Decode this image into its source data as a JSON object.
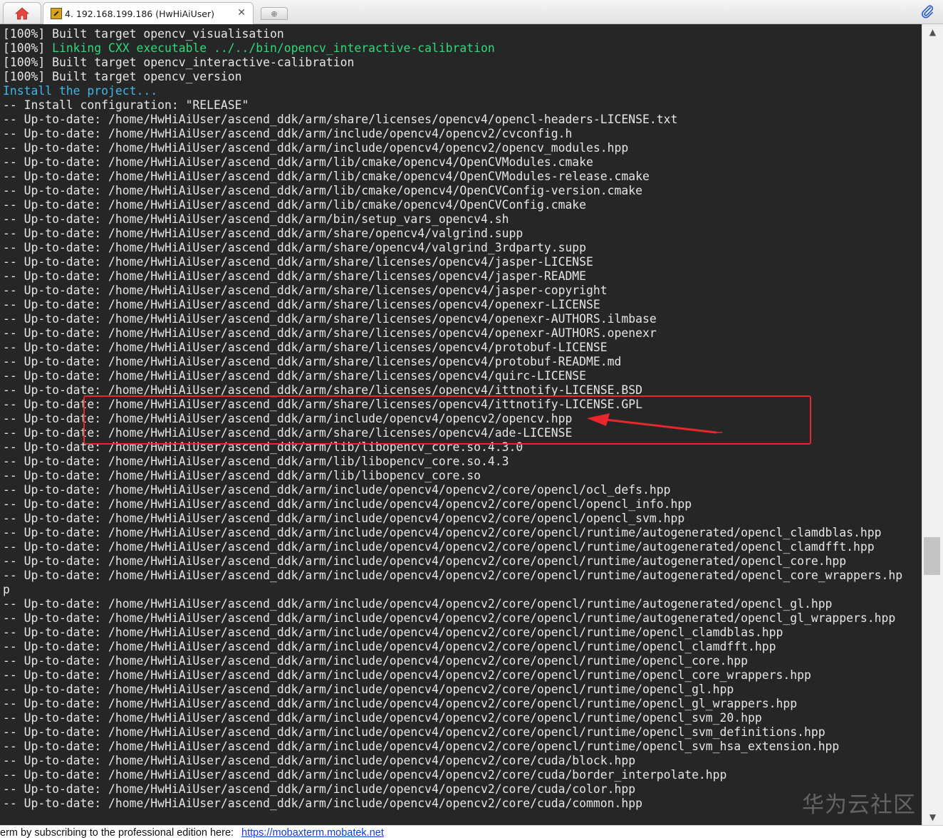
{
  "tabbar": {
    "session_tab_title": "4. 192.168.199.186 (HwHiAiUser)",
    "close_glyph": "✕",
    "new_tab_glyph": "⊕"
  },
  "terminal": {
    "lines": [
      {
        "text": "[100%] Built target opencv_visualisation",
        "color": "default"
      },
      {
        "text": "[100%] Linking CXX executable ../../bin/opencv_interactive-calibration",
        "color": "green",
        "prefix": "[100%] "
      },
      {
        "text": "[100%] Built target opencv_interactive-calibration",
        "color": "default"
      },
      {
        "text": "[100%] Built target opencv_version",
        "color": "default"
      },
      {
        "text": "Install the project...",
        "color": "cyan"
      },
      {
        "text": "-- Install configuration: \"RELEASE\"",
        "color": "default"
      },
      {
        "text": "-- Up-to-date: /home/HwHiAiUser/ascend_ddk/arm/share/licenses/opencv4/opencl-headers-LICENSE.txt",
        "color": "default"
      },
      {
        "text": "-- Up-to-date: /home/HwHiAiUser/ascend_ddk/arm/include/opencv4/opencv2/cvconfig.h",
        "color": "default"
      },
      {
        "text": "-- Up-to-date: /home/HwHiAiUser/ascend_ddk/arm/include/opencv4/opencv2/opencv_modules.hpp",
        "color": "default"
      },
      {
        "text": "-- Up-to-date: /home/HwHiAiUser/ascend_ddk/arm/lib/cmake/opencv4/OpenCVModules.cmake",
        "color": "default"
      },
      {
        "text": "-- Up-to-date: /home/HwHiAiUser/ascend_ddk/arm/lib/cmake/opencv4/OpenCVModules-release.cmake",
        "color": "default"
      },
      {
        "text": "-- Up-to-date: /home/HwHiAiUser/ascend_ddk/arm/lib/cmake/opencv4/OpenCVConfig-version.cmake",
        "color": "default"
      },
      {
        "text": "-- Up-to-date: /home/HwHiAiUser/ascend_ddk/arm/lib/cmake/opencv4/OpenCVConfig.cmake",
        "color": "default"
      },
      {
        "text": "-- Up-to-date: /home/HwHiAiUser/ascend_ddk/arm/bin/setup_vars_opencv4.sh",
        "color": "default"
      },
      {
        "text": "-- Up-to-date: /home/HwHiAiUser/ascend_ddk/arm/share/opencv4/valgrind.supp",
        "color": "default"
      },
      {
        "text": "-- Up-to-date: /home/HwHiAiUser/ascend_ddk/arm/share/opencv4/valgrind_3rdparty.supp",
        "color": "default"
      },
      {
        "text": "-- Up-to-date: /home/HwHiAiUser/ascend_ddk/arm/share/licenses/opencv4/jasper-LICENSE",
        "color": "default"
      },
      {
        "text": "-- Up-to-date: /home/HwHiAiUser/ascend_ddk/arm/share/licenses/opencv4/jasper-README",
        "color": "default"
      },
      {
        "text": "-- Up-to-date: /home/HwHiAiUser/ascend_ddk/arm/share/licenses/opencv4/jasper-copyright",
        "color": "default"
      },
      {
        "text": "-- Up-to-date: /home/HwHiAiUser/ascend_ddk/arm/share/licenses/opencv4/openexr-LICENSE",
        "color": "default"
      },
      {
        "text": "-- Up-to-date: /home/HwHiAiUser/ascend_ddk/arm/share/licenses/opencv4/openexr-AUTHORS.ilmbase",
        "color": "default"
      },
      {
        "text": "-- Up-to-date: /home/HwHiAiUser/ascend_ddk/arm/share/licenses/opencv4/openexr-AUTHORS.openexr",
        "color": "default"
      },
      {
        "text": "-- Up-to-date: /home/HwHiAiUser/ascend_ddk/arm/share/licenses/opencv4/protobuf-LICENSE",
        "color": "default"
      },
      {
        "text": "-- Up-to-date: /home/HwHiAiUser/ascend_ddk/arm/share/licenses/opencv4/protobuf-README.md",
        "color": "default"
      },
      {
        "text": "-- Up-to-date: /home/HwHiAiUser/ascend_ddk/arm/share/licenses/opencv4/quirc-LICENSE",
        "color": "default"
      },
      {
        "text": "-- Up-to-date: /home/HwHiAiUser/ascend_ddk/arm/share/licenses/opencv4/ittnotify-LICENSE.BSD",
        "color": "default"
      },
      {
        "text": "-- Up-to-date: /home/HwHiAiUser/ascend_ddk/arm/share/licenses/opencv4/ittnotify-LICENSE.GPL",
        "color": "default"
      },
      {
        "text": "-- Up-to-date: /home/HwHiAiUser/ascend_ddk/arm/include/opencv4/opencv2/opencv.hpp",
        "color": "default"
      },
      {
        "text": "-- Up-to-date: /home/HwHiAiUser/ascend_ddk/arm/share/licenses/opencv4/ade-LICENSE",
        "color": "default"
      },
      {
        "text": "-- Up-to-date: /home/HwHiAiUser/ascend_ddk/arm/lib/libopencv_core.so.4.3.0",
        "color": "default"
      },
      {
        "text": "-- Up-to-date: /home/HwHiAiUser/ascend_ddk/arm/lib/libopencv_core.so.4.3",
        "color": "default"
      },
      {
        "text": "-- Up-to-date: /home/HwHiAiUser/ascend_ddk/arm/lib/libopencv_core.so",
        "color": "default"
      },
      {
        "text": "-- Up-to-date: /home/HwHiAiUser/ascend_ddk/arm/include/opencv4/opencv2/core/opencl/ocl_defs.hpp",
        "color": "default"
      },
      {
        "text": "-- Up-to-date: /home/HwHiAiUser/ascend_ddk/arm/include/opencv4/opencv2/core/opencl/opencl_info.hpp",
        "color": "default"
      },
      {
        "text": "-- Up-to-date: /home/HwHiAiUser/ascend_ddk/arm/include/opencv4/opencv2/core/opencl/opencl_svm.hpp",
        "color": "default"
      },
      {
        "text": "-- Up-to-date: /home/HwHiAiUser/ascend_ddk/arm/include/opencv4/opencv2/core/opencl/runtime/autogenerated/opencl_clamdblas.hpp",
        "color": "default"
      },
      {
        "text": "-- Up-to-date: /home/HwHiAiUser/ascend_ddk/arm/include/opencv4/opencv2/core/opencl/runtime/autogenerated/opencl_clamdfft.hpp",
        "color": "default"
      },
      {
        "text": "-- Up-to-date: /home/HwHiAiUser/ascend_ddk/arm/include/opencv4/opencv2/core/opencl/runtime/autogenerated/opencl_core.hpp",
        "color": "default"
      },
      {
        "text": "-- Up-to-date: /home/HwHiAiUser/ascend_ddk/arm/include/opencv4/opencv2/core/opencl/runtime/autogenerated/opencl_core_wrappers.hp",
        "color": "default"
      },
      {
        "text": "p",
        "color": "default"
      },
      {
        "text": "-- Up-to-date: /home/HwHiAiUser/ascend_ddk/arm/include/opencv4/opencv2/core/opencl/runtime/autogenerated/opencl_gl.hpp",
        "color": "default"
      },
      {
        "text": "-- Up-to-date: /home/HwHiAiUser/ascend_ddk/arm/include/opencv4/opencv2/core/opencl/runtime/autogenerated/opencl_gl_wrappers.hpp",
        "color": "default"
      },
      {
        "text": "-- Up-to-date: /home/HwHiAiUser/ascend_ddk/arm/include/opencv4/opencv2/core/opencl/runtime/opencl_clamdblas.hpp",
        "color": "default"
      },
      {
        "text": "-- Up-to-date: /home/HwHiAiUser/ascend_ddk/arm/include/opencv4/opencv2/core/opencl/runtime/opencl_clamdfft.hpp",
        "color": "default"
      },
      {
        "text": "-- Up-to-date: /home/HwHiAiUser/ascend_ddk/arm/include/opencv4/opencv2/core/opencl/runtime/opencl_core.hpp",
        "color": "default"
      },
      {
        "text": "-- Up-to-date: /home/HwHiAiUser/ascend_ddk/arm/include/opencv4/opencv2/core/opencl/runtime/opencl_core_wrappers.hpp",
        "color": "default"
      },
      {
        "text": "-- Up-to-date: /home/HwHiAiUser/ascend_ddk/arm/include/opencv4/opencv2/core/opencl/runtime/opencl_gl.hpp",
        "color": "default"
      },
      {
        "text": "-- Up-to-date: /home/HwHiAiUser/ascend_ddk/arm/include/opencv4/opencv2/core/opencl/runtime/opencl_gl_wrappers.hpp",
        "color": "default"
      },
      {
        "text": "-- Up-to-date: /home/HwHiAiUser/ascend_ddk/arm/include/opencv4/opencv2/core/opencl/runtime/opencl_svm_20.hpp",
        "color": "default"
      },
      {
        "text": "-- Up-to-date: /home/HwHiAiUser/ascend_ddk/arm/include/opencv4/opencv2/core/opencl/runtime/opencl_svm_definitions.hpp",
        "color": "default"
      },
      {
        "text": "-- Up-to-date: /home/HwHiAiUser/ascend_ddk/arm/include/opencv4/opencv2/core/opencl/runtime/opencl_svm_hsa_extension.hpp",
        "color": "default"
      },
      {
        "text": "-- Up-to-date: /home/HwHiAiUser/ascend_ddk/arm/include/opencv4/opencv2/core/cuda/block.hpp",
        "color": "default"
      },
      {
        "text": "-- Up-to-date: /home/HwHiAiUser/ascend_ddk/arm/include/opencv4/opencv2/core/cuda/border_interpolate.hpp",
        "color": "default"
      },
      {
        "text": "-- Up-to-date: /home/HwHiAiUser/ascend_ddk/arm/include/opencv4/opencv2/core/cuda/color.hpp",
        "color": "default"
      },
      {
        "text": "-- Up-to-date: /home/HwHiAiUser/ascend_ddk/arm/include/opencv4/opencv2/core/cuda/common.hpp",
        "color": "default"
      }
    ]
  },
  "watermark": "华为云社区",
  "statusbar": {
    "text": "erm by subscribing to the professional edition here:",
    "link": "https://mobaxterm.mobatek.net"
  },
  "colors": {
    "terminal_bg": "#262626",
    "text_default": "#e6e6e6",
    "text_green": "#2fd97a",
    "text_cyan": "#3fb6e8",
    "annotation_red": "#e8262c",
    "link": "#0a3fcf"
  },
  "icons": {
    "home": "home-icon",
    "session": "ssh-session-icon",
    "attach": "paperclip-icon"
  }
}
